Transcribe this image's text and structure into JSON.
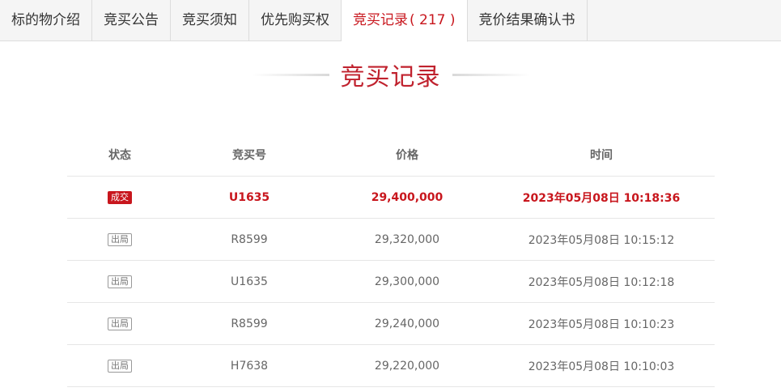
{
  "tabs": [
    {
      "label": "标的物介绍",
      "count": ""
    },
    {
      "label": "竞买公告",
      "count": ""
    },
    {
      "label": "竞买须知",
      "count": ""
    },
    {
      "label": "优先购买权",
      "count": ""
    },
    {
      "label": "竞买记录",
      "count": "( 217 )"
    },
    {
      "label": "竞价结果确认书",
      "count": ""
    }
  ],
  "section": {
    "title": "竞买记录"
  },
  "table": {
    "headers": {
      "status": "状态",
      "bid_no": "竞买号",
      "price": "价格",
      "time": "时间"
    },
    "rows": [
      {
        "status": "成交",
        "bid_no": "U1635",
        "price": "29,400,000",
        "time": "2023年05月08日 10:18:36"
      },
      {
        "status": "出局",
        "bid_no": "R8599",
        "price": "29,320,000",
        "time": "2023年05月08日 10:15:12"
      },
      {
        "status": "出局",
        "bid_no": "U1635",
        "price": "29,300,000",
        "time": "2023年05月08日 10:12:18"
      },
      {
        "status": "出局",
        "bid_no": "R8599",
        "price": "29,240,000",
        "time": "2023年05月08日 10:10:23"
      },
      {
        "status": "出局",
        "bid_no": "H7638",
        "price": "29,220,000",
        "time": "2023年05月08日 10:10:03"
      }
    ]
  },
  "colors": {
    "accent": "#c8161d",
    "title": "#c0222e"
  }
}
